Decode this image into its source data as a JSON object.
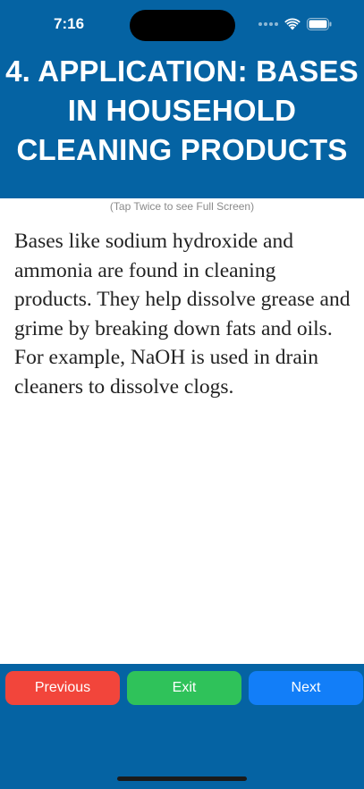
{
  "status_bar": {
    "time": "7:16"
  },
  "header": {
    "title": "4. APPLICATION: BASES IN HOUSEHOLD CLEANING PRODUCTS"
  },
  "hint": "(Tap Twice to see Full Screen)",
  "content": {
    "body": "Bases like sodium hydroxide and ammonia are found in cleaning products. They help dissolve grease and grime by breaking down fats and oils. For example, NaOH is used in drain cleaners to dissolve clogs."
  },
  "footer": {
    "previous_label": "Previous",
    "exit_label": "Exit",
    "next_label": "Next"
  },
  "colors": {
    "header_blue": "#0563a3",
    "previous_red": "#f2453b",
    "exit_green": "#2fc25a",
    "next_blue": "#127ef8"
  }
}
